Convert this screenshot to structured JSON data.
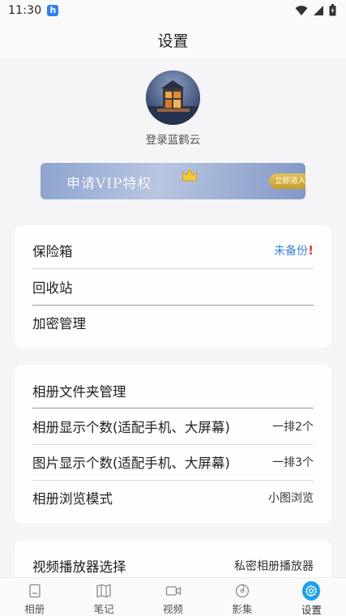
{
  "status_bar": {
    "time": "11:30",
    "app_icon_letter": "h"
  },
  "header": {
    "title": "设置"
  },
  "profile": {
    "login_text": "登录蓝鹤云"
  },
  "vip": {
    "title": "申请VIP特权",
    "button": "立即进入"
  },
  "security_card": {
    "items": [
      {
        "label": "保险箱",
        "value": "未备份",
        "warning": "!"
      },
      {
        "label": "回收站"
      },
      {
        "label": "加密管理"
      }
    ]
  },
  "album_card": {
    "items": [
      {
        "label": "相册文件夹管理"
      },
      {
        "label": "相册显示个数(适配手机、大屏幕)",
        "value": "一排2个"
      },
      {
        "label": "图片显示个数(适配手机、大屏幕)",
        "value": "一排3个"
      },
      {
        "label": "相册浏览模式",
        "value": "小图浏览"
      }
    ]
  },
  "player_card": {
    "items": [
      {
        "label": "视频播放器选择",
        "value": "私密相册播放器"
      }
    ]
  },
  "tabbar": {
    "tabs": [
      {
        "label": "相册",
        "icon": "album-icon"
      },
      {
        "label": "笔记",
        "icon": "notebook-icon"
      },
      {
        "label": "视频",
        "icon": "video-camera-icon"
      },
      {
        "label": "影集",
        "icon": "film-reel-icon"
      },
      {
        "label": "设置",
        "icon": "gear-icon",
        "active": true
      }
    ]
  },
  "colors": {
    "accent_blue": "#3f7fd8",
    "active_tab": "#1ea0e8",
    "warning_red": "#e53935",
    "vip_gold": "#d4ad3a"
  }
}
